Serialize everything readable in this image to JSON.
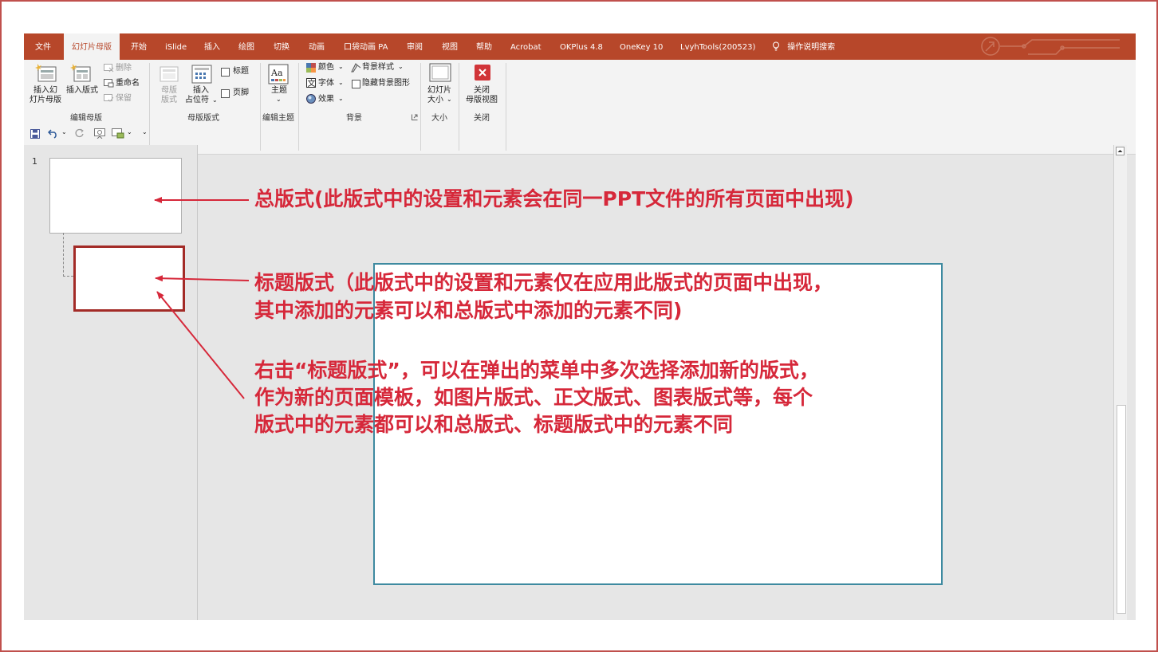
{
  "ribbon_tabs": [
    "文件",
    "幻灯片母版",
    "开始",
    "iSlide",
    "插入",
    "绘图",
    "切换",
    "动画",
    "口袋动画 PA",
    "审阅",
    "视图",
    "帮助",
    "Acrobat",
    "OKPlus 4.8",
    "OneKey 10",
    "LvyhTools(200523)"
  ],
  "tell_me": "操作说明搜索",
  "groups": {
    "edit_master": {
      "label": "编辑母版",
      "insert_slide_master": [
        "插入幻",
        "灯片母版"
      ],
      "insert_layout": "插入版式",
      "delete": "删除",
      "rename": "重命名",
      "preserve": "保留"
    },
    "master_layout": {
      "label": "母版版式",
      "master_layout_btn": [
        "母版",
        "版式"
      ],
      "insert_placeholder": [
        "插入",
        "占位符"
      ],
      "title_checkbox": "标题",
      "footer_checkbox": "页脚"
    },
    "edit_theme": {
      "label": "编辑主题",
      "theme": "主题"
    },
    "background": {
      "label": "背景",
      "colors": "颜色",
      "fonts": "字体",
      "effects": "效果",
      "bg_styles": "背景样式",
      "hide_bg_graphics": "隐藏背景图形"
    },
    "size": {
      "label": "大小",
      "slide_size": [
        "幻灯片",
        "大小"
      ]
    },
    "close": {
      "label": "关闭",
      "close_master": [
        "关闭",
        "母版视图"
      ]
    }
  },
  "thumbnail_number": "1",
  "annotations": {
    "master": "总版式(此版式中的设置和元素会在同一PPT文件的所有页面中出现)",
    "title_layout_line1": "标题版式（此版式中的设置和元素仅在应用此版式的页面中出现，",
    "title_layout_line2": "其中添加的元素可以和总版式中添加的元素不同)",
    "right_click_line1": "右击“标题版式”，可以在弹出的菜单中多次选择添加新的版式，",
    "right_click_line2": "作为新的页面模板，如图片版式、正文版式、图表版式等，每个",
    "right_click_line3": "版式中的元素都可以和总版式、标题版式中的元素不同"
  },
  "colors": {
    "ribbon_tab_bg": "#b7472a",
    "annotation": "#d6283a",
    "frame": "#c0504d"
  }
}
